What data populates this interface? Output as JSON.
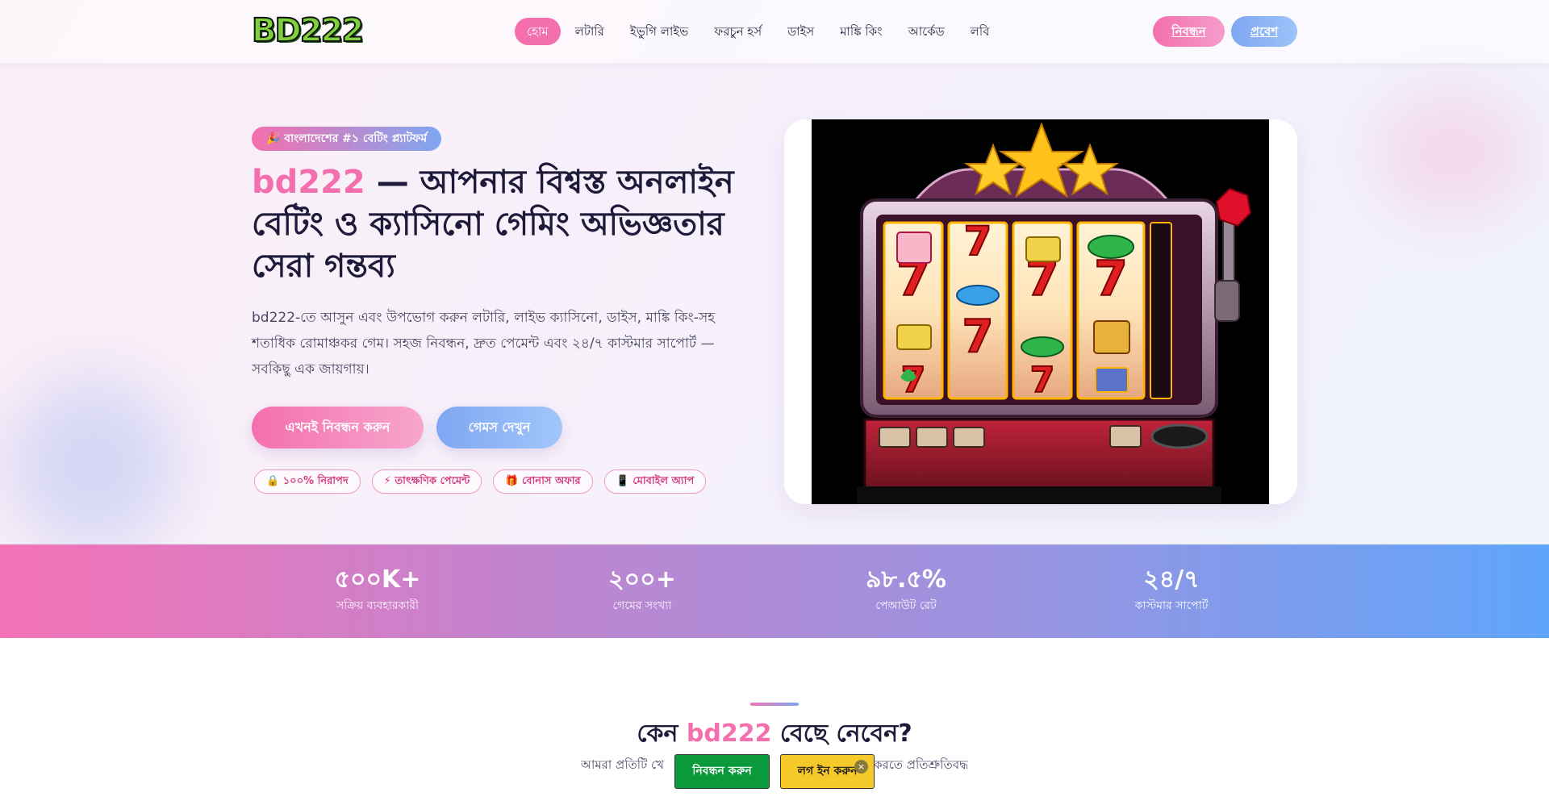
{
  "header": {
    "logo": "BD222",
    "nav": [
      "হোম",
      "লটারি",
      "ইভুগি লাইভ",
      "ফরচুন হর্স",
      "ডাইস",
      "মাঙ্কি কিং",
      "আর্কেড",
      "লবি"
    ],
    "register": "নিবন্ধন",
    "login": "প্রবেশ"
  },
  "hero": {
    "badge": "🎉 বাংলাদেশের #১ বেটিং প্ল্যাটফর্ম",
    "title_brand": "bd222",
    "title_rest": " — আপনার বিশ্বস্ত অনলাইন বেটিং ও ক্যাসিনো গেমিং অভিজ্ঞতার সেরা গন্তব্য",
    "description": "bd222-তে আসুন এবং উপভোগ করুন লটারি, লাইভ ক্যাসিনো, ডাইস, মাঙ্কি কিং-সহ শতাধিক রোমাঞ্চকর গেম। সহজ নিবন্ধন, দ্রুত পেমেন্ট এবং ২৪/৭ কাস্টমার সাপোর্ট — সবকিছু এক জায়গায়।",
    "cta_primary": "এখনই নিবন্ধন করুন",
    "cta_secondary": "গেমস দেখুন",
    "chips": [
      "🔒 ১০০% নিরাপদ",
      "⚡ তাৎক্ষণিক পেমেন্ট",
      "🎁 বোনাস অফার",
      "📱 মোবাইল অ্যাপ"
    ]
  },
  "stats": [
    {
      "value": "৫০০K+",
      "label": "সক্রিয় ব্যবহারকারী"
    },
    {
      "value": "২০০+",
      "label": "গেমের সংখ্যা"
    },
    {
      "value": "৯৮.৫%",
      "label": "পেআউট রেট"
    },
    {
      "value": "২৪/৭",
      "label": "কাস্টমার সাপোর্ট"
    }
  ],
  "why": {
    "title_pre": "কেন ",
    "title_brand": "bd222",
    "title_post": " বেছে নেবেন?",
    "subtitle_left": "আমরা প্রতিটি খে",
    "subtitle_right": "করতে প্রতিশ্রুতিবদ্ধ"
  },
  "floating": {
    "register": "নিবন্ধন করুন",
    "login": "লগ ইন করুন",
    "close": "×"
  },
  "colors": {
    "accent_pink": "#f46fad",
    "accent_blue": "#7fa6f2"
  }
}
